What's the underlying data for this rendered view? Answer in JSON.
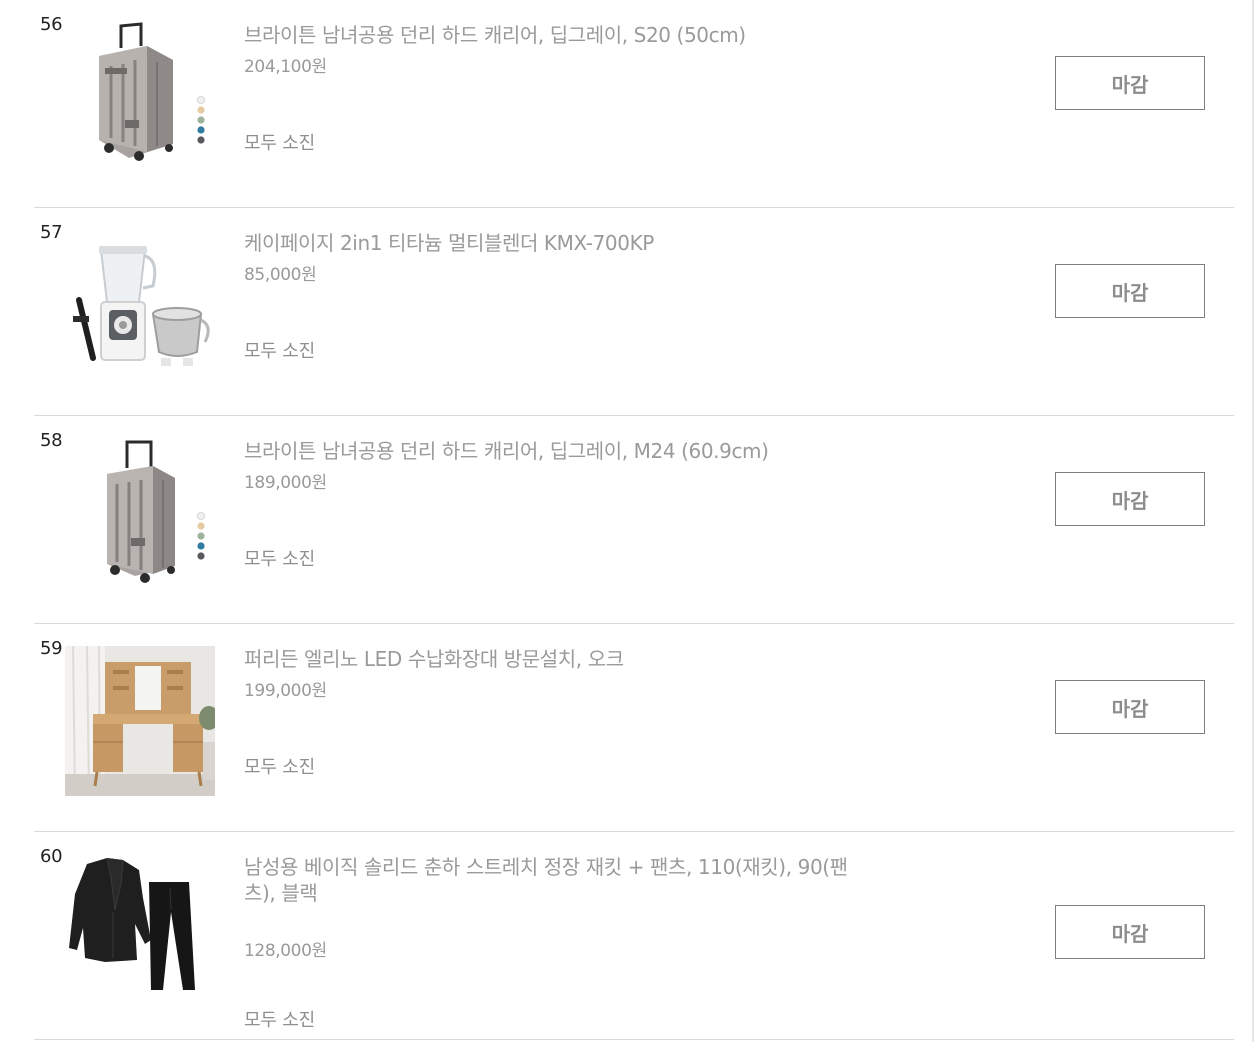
{
  "products": [
    {
      "index": "56",
      "title": "브라이튼 남녀공용 던리 하드 캐리어, 딥그레이, S20 (50cm)",
      "price": "204,100원",
      "status": "모두 소진",
      "button": "마감",
      "image": "grey-suitcase-small",
      "color_swatches": [
        "#f0eef0",
        "#e7c9a2",
        "#9fb29b",
        "#2f7ba1",
        "#595a5e"
      ]
    },
    {
      "index": "57",
      "title": "케이페이지 2in1 티타늄 멀티블렌더 KMX-700KP",
      "price": "85,000원",
      "status": "모두 소진",
      "button": "마감",
      "image": "multi-blender"
    },
    {
      "index": "58",
      "title": "브라이튼 남녀공용 던리 하드 캐리어, 딥그레이, M24 (60.9cm)",
      "price": "189,000원",
      "status": "모두 소진",
      "button": "마감",
      "image": "grey-suitcase-medium",
      "color_swatches": [
        "#f0eef0",
        "#e7c9a2",
        "#9fb29b",
        "#2f7ba1",
        "#595a5e"
      ]
    },
    {
      "index": "59",
      "title": "퍼리든 엘리노 LED 수납화장대 방문설치, 오크",
      "price": "199,000원",
      "status": "모두 소진",
      "button": "마감",
      "image": "oak-vanity-dresser"
    },
    {
      "index": "60",
      "title": "남성용 베이직 솔리드 춘하 스트레치 정장 재킷 + 팬츠, 110(재킷), 90(팬츠), 블랙",
      "price": "128,000원",
      "status": "모두 소진",
      "button": "마감",
      "image": "black-suit"
    }
  ]
}
